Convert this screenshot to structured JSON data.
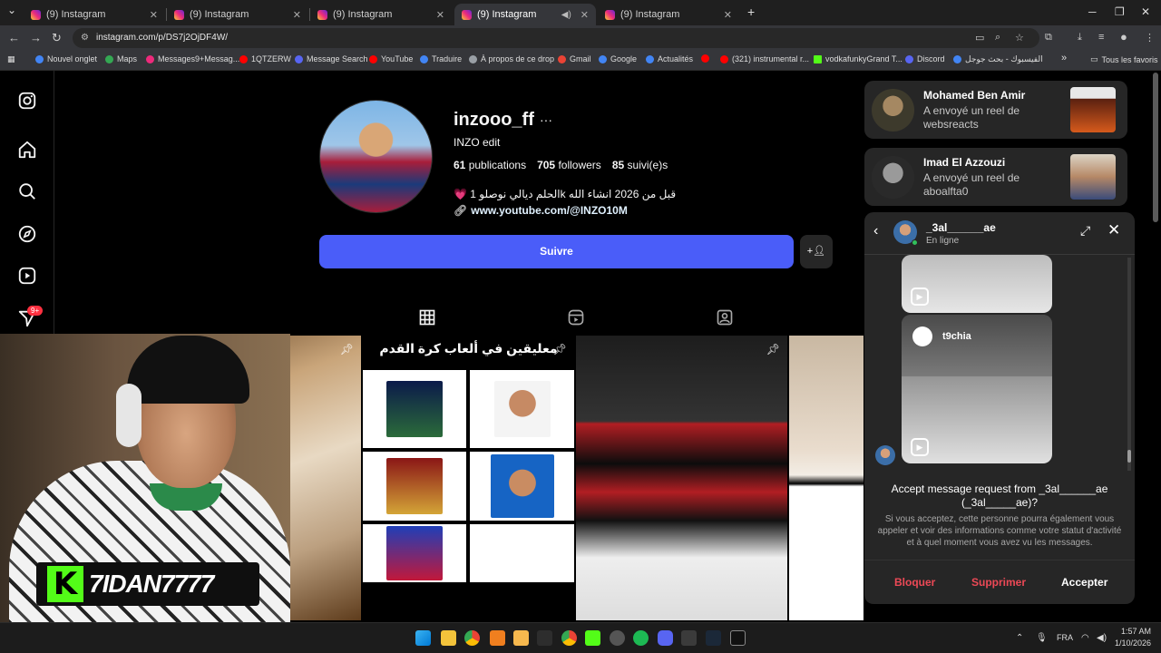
{
  "browser": {
    "tabs": [
      {
        "title": "(9) Instagram"
      },
      {
        "title": "(9) Instagram"
      },
      {
        "title": "(9) Instagram"
      },
      {
        "title": "(9) Instagram"
      },
      {
        "title": "(9) Instagram"
      }
    ],
    "url": "instagram.com/p/DS7j2OjDF4W/",
    "bookmarks": [
      {
        "label": "Nouvel onglet",
        "color": "#4285f4"
      },
      {
        "label": "Maps",
        "color": "#34a853"
      },
      {
        "label": "Messages9+Messag...",
        "color": "#ee2a7b"
      },
      {
        "label": "1QTZERW",
        "color": "#ff0000"
      },
      {
        "label": "Message Search",
        "color": "#5865f2"
      },
      {
        "label": "YouTube",
        "color": "#ff0000"
      },
      {
        "label": "Traduire",
        "color": "#4285f4"
      },
      {
        "label": "À propos de ce drop",
        "color": "#9aa0a6"
      },
      {
        "label": "Gmail",
        "color": "#ea4335"
      },
      {
        "label": "Google",
        "color": "#4285f4"
      },
      {
        "label": "Actualités",
        "color": "#4285f4"
      },
      {
        "label": "",
        "color": "#ff0000"
      },
      {
        "label": "(321) instrumental r...",
        "color": "#ff0000"
      },
      {
        "label": "vodkafunkyGrand T...",
        "color": "#53fc18"
      },
      {
        "label": "Discord",
        "color": "#5865f2"
      },
      {
        "label": "الفيسبوك - بحث جوجل",
        "color": "#4285f4"
      }
    ],
    "all_bookmarks": "Tous les favoris"
  },
  "profile": {
    "username": "inzooo_ff",
    "fullname": "INZO edit",
    "publications_count": "61",
    "publications_label": "publications",
    "followers_count": "705",
    "followers_label": "followers",
    "following_count": "85",
    "following_label": "suivi(e)s",
    "bio": "💗 الحلم ديالي نوصلو 1k قبل من 2026 انشاء الله",
    "link": "www.youtube.com/@INZO10M",
    "follow_button": "Suivre"
  },
  "posts": {
    "post2_title": "معليقين في ألعاب كرة القدم"
  },
  "sidebar": {
    "notifications_badge": "9+"
  },
  "streamer": {
    "name": "7IDAN7777"
  },
  "notifications": [
    {
      "name": "Mohamed Ben Amir",
      "message": "A envoyé un reel de websreacts"
    },
    {
      "name": "Imad El Azzouzi",
      "message": "A envoyé un reel de aboalfta0"
    }
  ],
  "chat": {
    "name": "_3al______ae",
    "status": "En ligne",
    "reel_user": "t9chia",
    "request_title": "Accept message request from _3al______ae (_3al_____ae)?",
    "request_desc": "Si vous acceptez, cette personne pourra également vous appeler et voir des informations comme votre statut d'activité et à quel moment vous avez vu les messages.",
    "btn_block": "Bloquer",
    "btn_delete": "Supprimer",
    "btn_accept": "Accepter"
  },
  "taskbar": {
    "language": "FRA",
    "time": "1:57 AM",
    "date": "1/10/2026"
  }
}
